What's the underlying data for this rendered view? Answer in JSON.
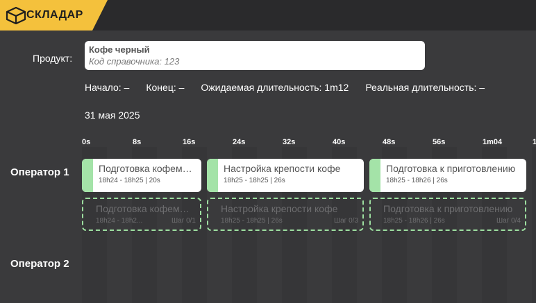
{
  "app": {
    "name": "СКЛАДАР",
    "accent": "#f4c13c"
  },
  "product": {
    "label": "Продукт:",
    "name": "Кофе черный",
    "code": "Код справочника: 123"
  },
  "meta": {
    "start": "Начало: –",
    "end": "Конец: –",
    "expected": "Ожидаемая длительность: 1m12",
    "actual": "Реальная длительность: –"
  },
  "date": "31 мая 2025",
  "ticks": [
    "0s",
    "8s",
    "16s",
    "24s",
    "32s",
    "40s",
    "48s",
    "56s",
    "1m04",
    "1"
  ],
  "operators": [
    "Оператор 1",
    "Оператор 2"
  ],
  "tasks": [
    {
      "title": "Подготовка кофемашины",
      "time": "18h24 - 18h25 | 20s"
    },
    {
      "title": "Настройка крепости кофе",
      "time": "18h25 - 18h25 | 26s"
    },
    {
      "title": "Подготовка к приготовлению",
      "time": "18h25 - 18h26 | 26s"
    }
  ],
  "planned": [
    {
      "title": "Подготовка кофемашины",
      "time": "18h24 - 18h2...",
      "step": "Шаг 0/1"
    },
    {
      "title": "Настройка крепости кофе",
      "time": "18h25 - 18h25 | 26s",
      "step": "Шаг 0/3"
    },
    {
      "title": "Подготовка к приготовлению",
      "time": "18h25 - 18h26 | 26s",
      "step": "Шаг 0/4"
    }
  ]
}
